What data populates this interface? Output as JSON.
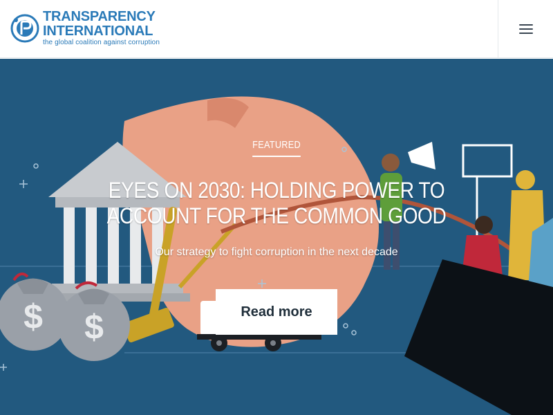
{
  "header": {
    "logo": {
      "line1": "TRANSPARENCY",
      "line2": "INTERNATIONAL",
      "tagline": "the global coalition against corruption"
    },
    "menu_icon": "hamburger-menu-icon"
  },
  "hero": {
    "eyebrow": "FEATURED",
    "title": "EYES ON 2030: HOLDING POWER TO ACCOUNT FOR THE COMMON GOOD",
    "subtitle": "Our strategy to fight corruption in the next decade",
    "cta_label": "Read more",
    "money_bag_symbol": "$",
    "colors": {
      "background": "#22597f",
      "accent": "#2a7ab8",
      "cta_background": "#ffffff"
    }
  }
}
